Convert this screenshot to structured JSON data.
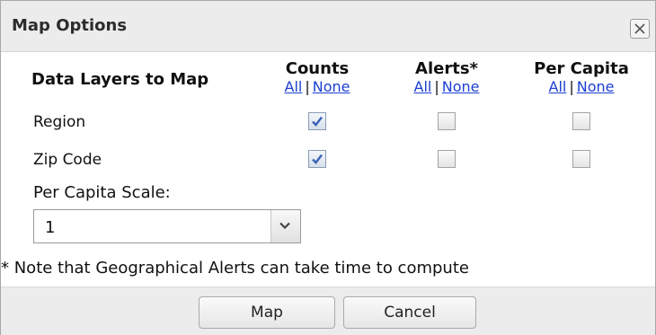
{
  "dialog": {
    "title": "Map Options",
    "close_icon": "close-icon"
  },
  "layers": {
    "header": "Data Layers to Map",
    "columns": [
      {
        "title": "Counts",
        "all": "All",
        "sep": "|",
        "none": "None"
      },
      {
        "title": "Alerts*",
        "all": "All",
        "sep": "|",
        "none": "None"
      },
      {
        "title": "Per Capita",
        "all": "All",
        "sep": "|",
        "none": "None"
      }
    ],
    "rows": [
      {
        "label": "Region",
        "counts": true,
        "alerts": false,
        "per_capita": false
      },
      {
        "label": "Zip Code",
        "counts": true,
        "alerts": false,
        "per_capita": false
      }
    ]
  },
  "scale": {
    "label": "Per Capita Scale:",
    "value": "1",
    "arrow_icon": "chevron-down-icon"
  },
  "note": "* Note that Geographical Alerts can take time to compute",
  "footer": {
    "map_label": "Map",
    "cancel_label": "Cancel"
  },
  "colors": {
    "link": "#1a3fd1",
    "checkmark": "#3a63b8",
    "titlebar": "#ececec"
  }
}
